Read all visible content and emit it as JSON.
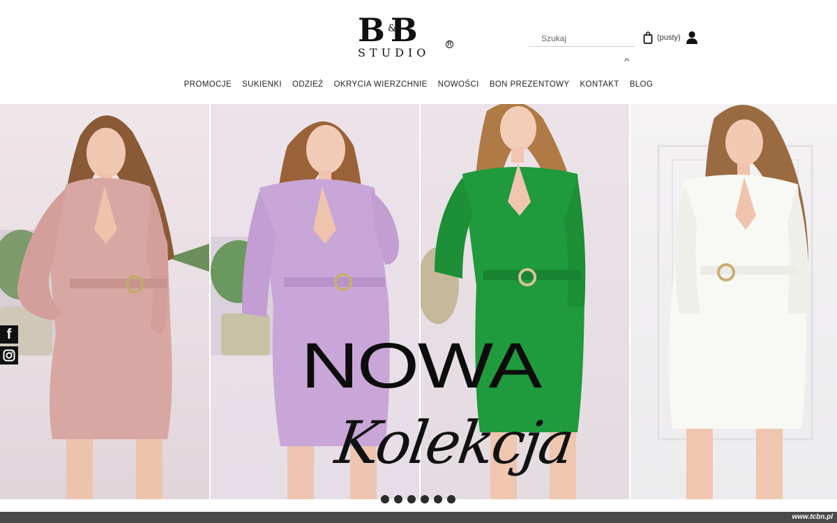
{
  "logo": {
    "main": "B&B",
    "sub": "STUDIO",
    "registered": "R"
  },
  "search": {
    "placeholder": "Szukaj"
  },
  "cart": {
    "status": "(pusty)"
  },
  "nav": {
    "items": [
      {
        "label": "PROMOCJE"
      },
      {
        "label": "SUKIENKI"
      },
      {
        "label": "ODZIEŻ"
      },
      {
        "label": "OKRYCIA WIERZCHNIE"
      },
      {
        "label": "NOWOŚCI"
      },
      {
        "label": "BON PREZENTOWY"
      },
      {
        "label": "KONTAKT"
      },
      {
        "label": "BLOG"
      }
    ]
  },
  "hero": {
    "headline": "NOWA",
    "script": "Kolekcja",
    "panels": [
      {
        "dress_color": "#d9a7a3"
      },
      {
        "dress_color": "#c9a6d8"
      },
      {
        "dress_color": "#1f9a3c"
      },
      {
        "dress_color": "#f8f8f4"
      }
    ],
    "slides_count": 6
  },
  "social": {
    "facebook_glyph": "f",
    "icons": [
      "facebook-icon",
      "instagram-icon"
    ]
  },
  "watermark": "www.tcbn.pl"
}
